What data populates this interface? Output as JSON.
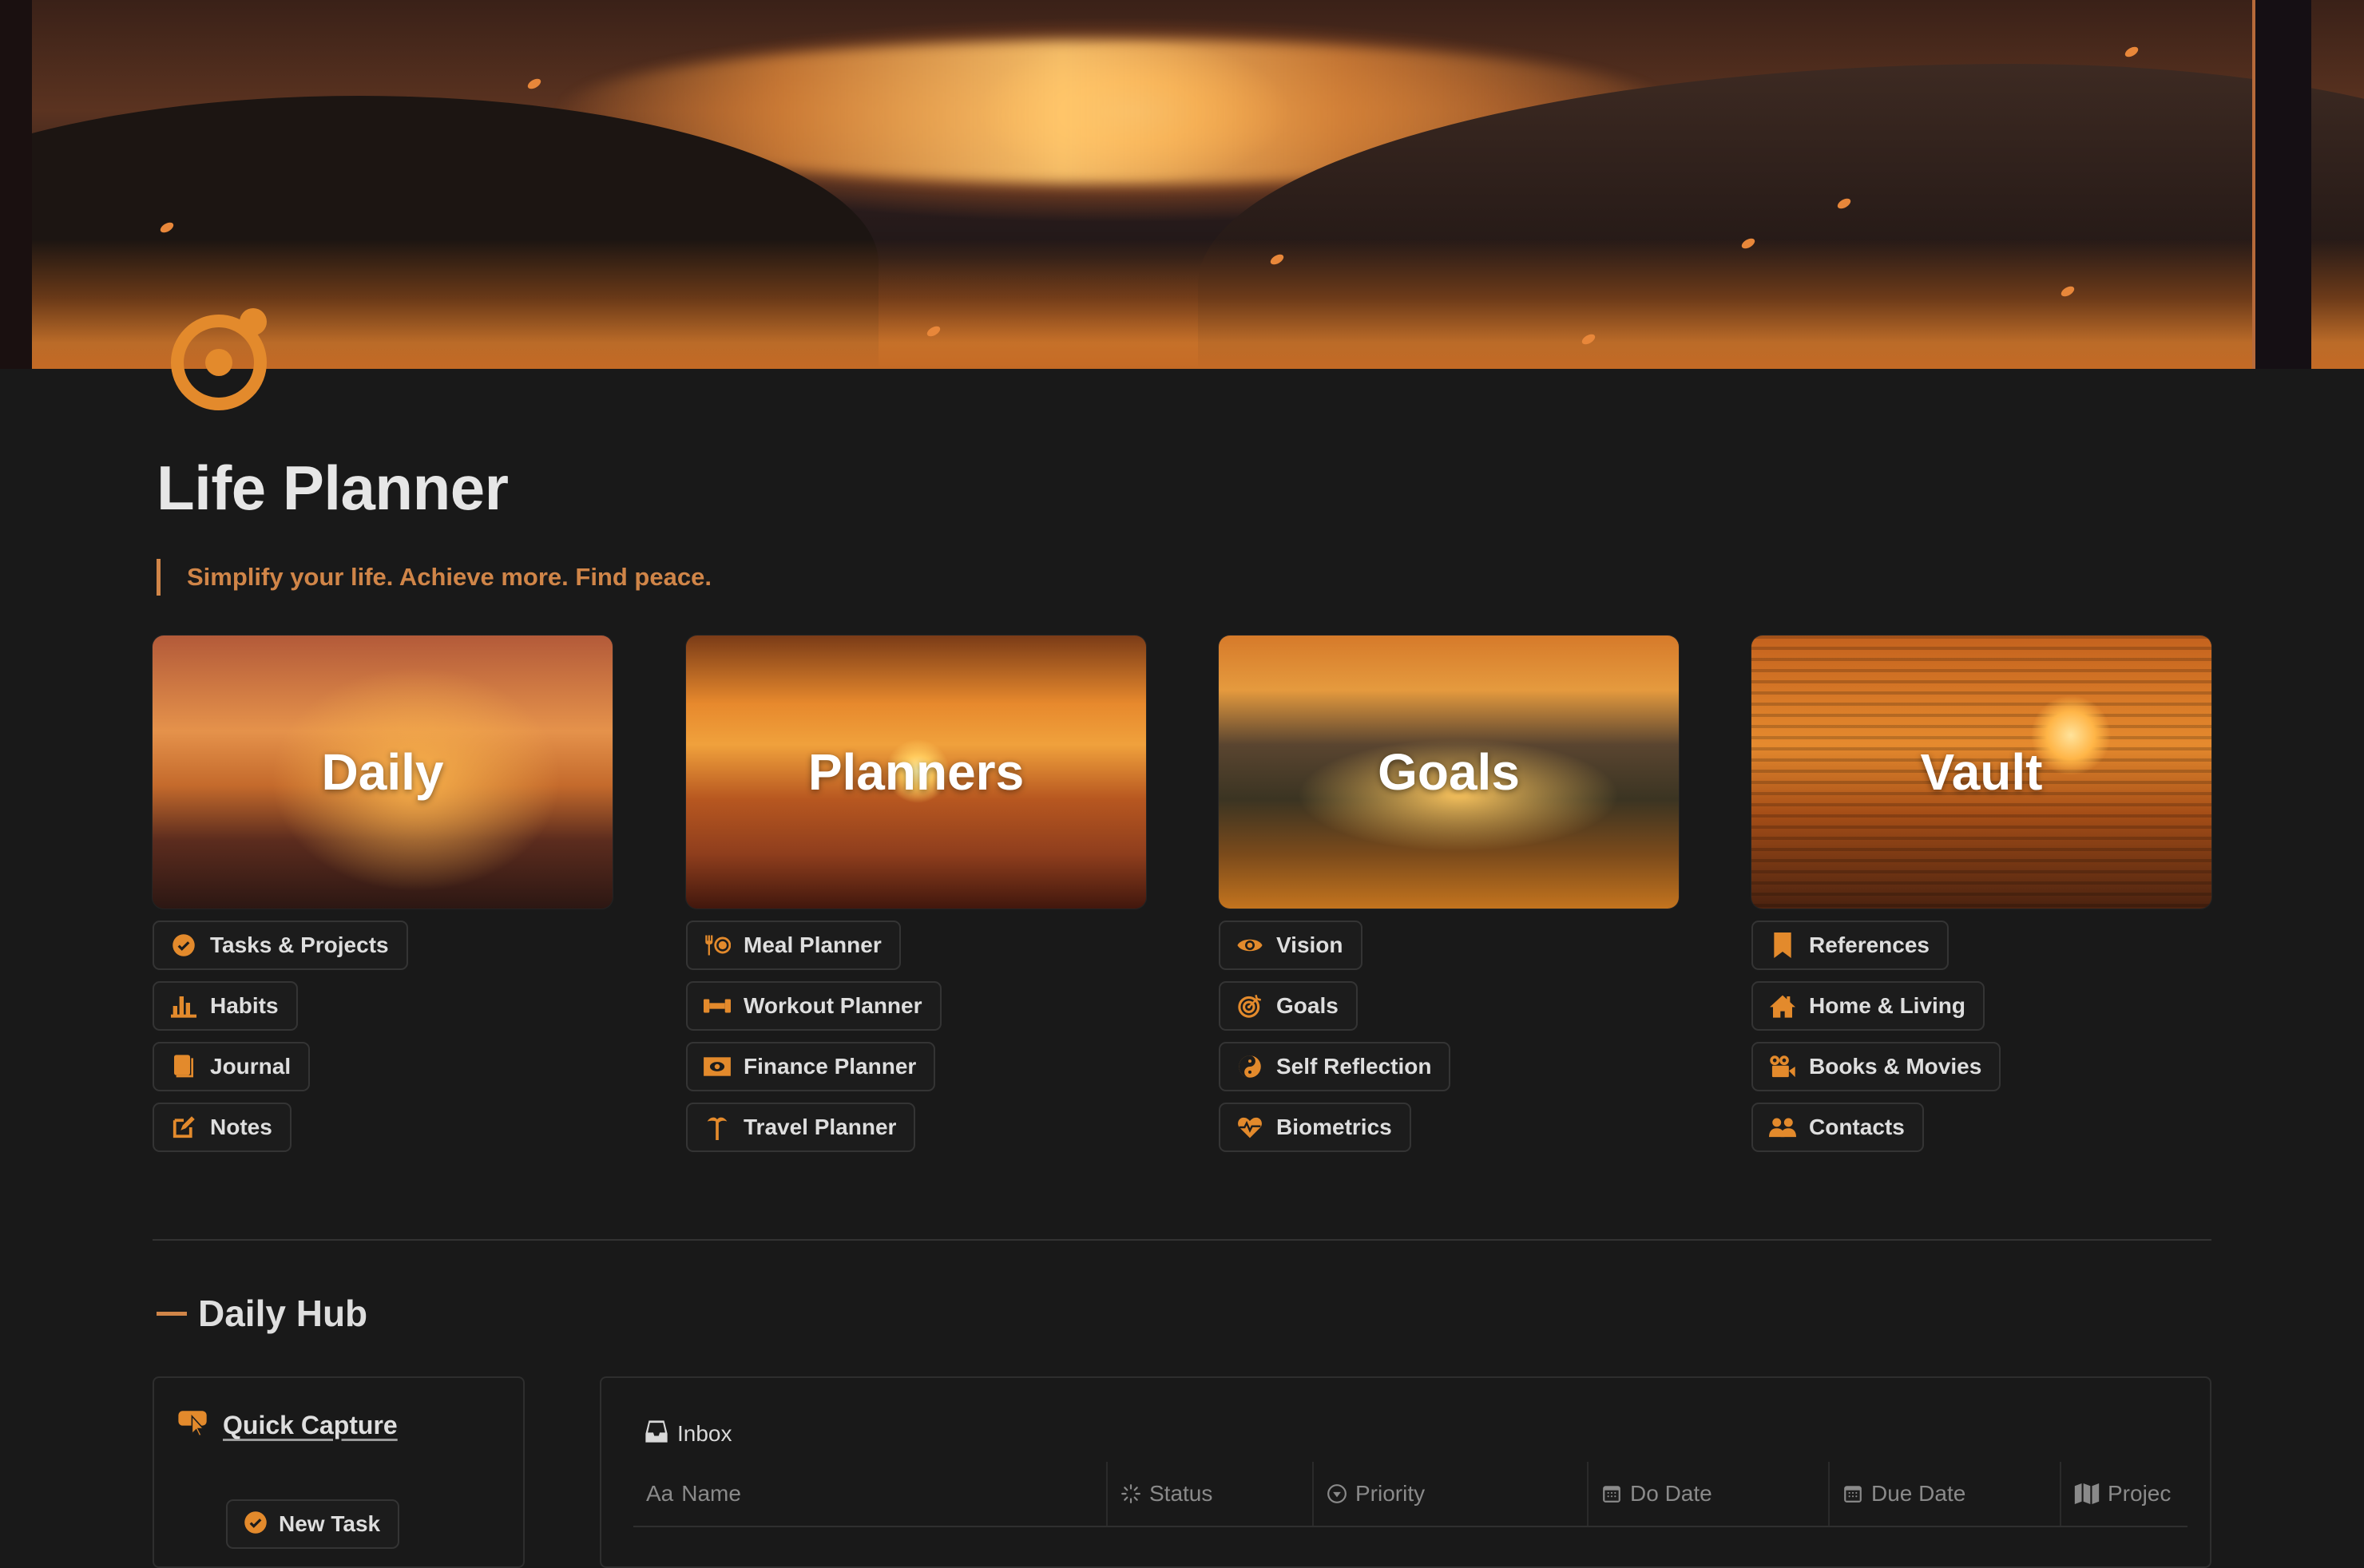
{
  "page": {
    "title": "Life Planner",
    "quote": "Simplify your life. Achieve more. Find peace.",
    "icon": "target-icon",
    "accent_color": "#e38a2c",
    "quote_color": "#d08548",
    "background_color": "#191919"
  },
  "cards": [
    {
      "title": "Daily",
      "links": [
        {
          "label": "Tasks & Projects",
          "icon": "check-circle-icon"
        },
        {
          "label": "Habits",
          "icon": "bar-chart-icon"
        },
        {
          "label": "Journal",
          "icon": "journal-icon"
        },
        {
          "label": "Notes",
          "icon": "edit-note-icon"
        }
      ]
    },
    {
      "title": "Planners",
      "links": [
        {
          "label": "Meal Planner",
          "icon": "fork-plate-icon"
        },
        {
          "label": "Workout Planner",
          "icon": "dumbbell-icon"
        },
        {
          "label": "Finance Planner",
          "icon": "banknote-icon"
        },
        {
          "label": "Travel Planner",
          "icon": "palm-tree-icon"
        }
      ]
    },
    {
      "title": "Goals",
      "links": [
        {
          "label": "Vision",
          "icon": "eye-icon"
        },
        {
          "label": "Goals",
          "icon": "target-arrow-icon"
        },
        {
          "label": "Self Reflection",
          "icon": "yin-yang-icon"
        },
        {
          "label": "Biometrics",
          "icon": "heart-pulse-icon"
        }
      ]
    },
    {
      "title": "Vault",
      "links": [
        {
          "label": "References",
          "icon": "bookmark-icon"
        },
        {
          "label": "Home & Living",
          "icon": "home-icon"
        },
        {
          "label": "Books & Movies",
          "icon": "movie-camera-icon"
        },
        {
          "label": "Contacts",
          "icon": "people-icon"
        }
      ]
    }
  ],
  "daily_hub": {
    "heading": "Daily Hub",
    "quick_capture": {
      "title": "Quick Capture",
      "icon": "click-pointer-icon",
      "new_task_label": "New Task"
    },
    "inbox": {
      "title": "Inbox",
      "icon": "inbox-tray-icon",
      "columns": [
        {
          "label": "Name",
          "icon_text": "Aa",
          "icon": "text-icon"
        },
        {
          "label": "Status",
          "icon": "status-spinner-icon"
        },
        {
          "label": "Priority",
          "icon": "select-circle-icon"
        },
        {
          "label": "Do Date",
          "icon": "calendar-icon"
        },
        {
          "label": "Due Date",
          "icon": "calendar-icon"
        },
        {
          "label": "Projec",
          "icon": "map-icon"
        }
      ]
    }
  }
}
